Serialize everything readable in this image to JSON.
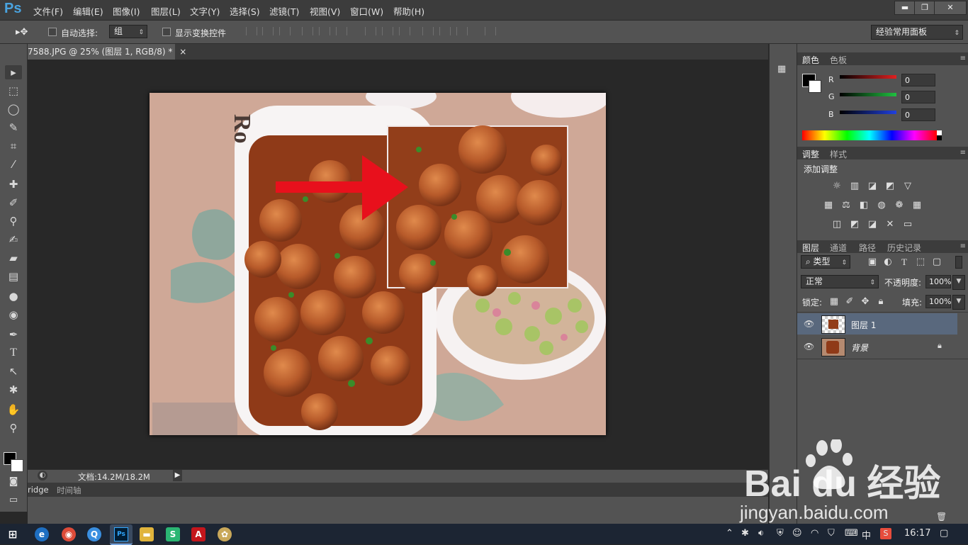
{
  "app": {
    "logo": "Ps"
  },
  "menu": [
    "文件(F)",
    "编辑(E)",
    "图像(I)",
    "图层(L)",
    "文字(Y)",
    "选择(S)",
    "滤镜(T)",
    "视图(V)",
    "窗口(W)",
    "帮助(H)"
  ],
  "window_controls": {
    "minimize": "▬",
    "restore": "❐",
    "close": "✕"
  },
  "options": {
    "auto_select_label": "自动选择:",
    "auto_select_value": "组",
    "show_transform_label": "显示变换控件",
    "workspace": "经验常用面板"
  },
  "document": {
    "tab_title": "7588.JPG @ 25% (图层 1, RGB/8) *",
    "close": "×",
    "status": "文档:14.2M/18.2M"
  },
  "bottom_tabs": [
    "ridge",
    "时间轴"
  ],
  "color_panel": {
    "tabs": [
      "颜色",
      "色板"
    ],
    "channels": [
      {
        "label": "R",
        "value": "0",
        "color": "#e02020"
      },
      {
        "label": "G",
        "value": "0",
        "color": "#20c040"
      },
      {
        "label": "B",
        "value": "0",
        "color": "#2040e0"
      }
    ]
  },
  "adjust_panel": {
    "tabs": [
      "调整",
      "样式"
    ],
    "title": "添加调整"
  },
  "layers_panel": {
    "tabs": [
      "图层",
      "通道",
      "路径",
      "历史记录"
    ],
    "filter_kind": "类型",
    "blend_mode": "正常",
    "opacity_label": "不透明度:",
    "opacity_value": "100%",
    "lock_label": "锁定:",
    "fill_label": "填充:",
    "fill_value": "100%",
    "layers": [
      {
        "name": "图层 1",
        "selected": true
      },
      {
        "name": "背景",
        "selected": false,
        "locked": true
      }
    ]
  },
  "taskbar": {
    "time": "16:17",
    "ime": "中"
  },
  "watermark": {
    "logo": "Bai du 经验",
    "url": "jingyan.baidu.com"
  },
  "colors": {
    "accent": "#4aa3df",
    "arrow": "#e8101c"
  }
}
